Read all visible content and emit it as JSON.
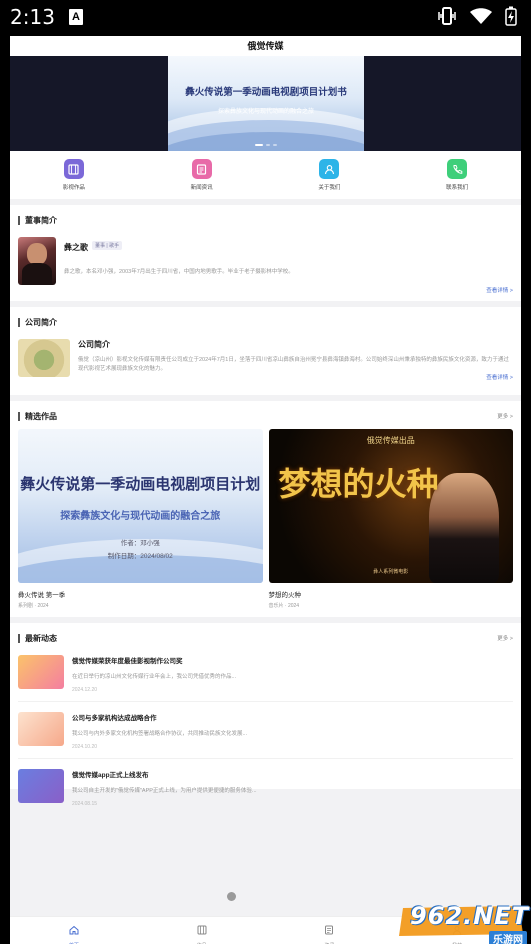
{
  "status_bar": {
    "time": "2:13",
    "notif_letter": "A"
  },
  "header": {
    "title": "俄觉传媒"
  },
  "banner": {
    "title": "彝火传说第一季动画电视剧项目计划书",
    "subtitle": "探索彝族文化与现代动画的融合之旅"
  },
  "quick_nav": [
    {
      "label": "影视作品",
      "icon": "film-icon",
      "color": "#7b68d8"
    },
    {
      "label": "新闻资讯",
      "icon": "news-icon",
      "color": "#e86aa8"
    },
    {
      "label": "关于我们",
      "icon": "user-icon",
      "color": "#2db4e8"
    },
    {
      "label": "联系我们",
      "icon": "phone-icon",
      "color": "#3ecf7a"
    }
  ],
  "chairman": {
    "section_title": "董事简介",
    "name": "彝之歌",
    "tag": "董事 | 歌手",
    "desc": "彝之歌，本名邓小强，2003年7月出生于四川省，中国内地男歌手。毕业于老子摄影林中学校。",
    "more": "查看详情 >"
  },
  "company": {
    "section_title": "公司简介",
    "name": "公司简介",
    "desc": "俄觉（凉山州）影视文化传媒有限责任公司成立于2024年7月1日，坐落于四川省凉山彝族自治州冕宁县彝海镇彝海村。公司始终深山州秉承独特的彝族民族文化资源，致力于通过现代影视艺术展现彝族文化的魅力。",
    "more": "查看详情 >"
  },
  "works": {
    "section_title": "精选作品",
    "more": "更多 >",
    "items": [
      {
        "name": "彝火传说 第一季",
        "meta": "系列剧 · 2024",
        "poster_title": "彝火传说第一季动画电视剧项目计划",
        "poster_sub": "探索彝族文化与现代动画的融合之旅",
        "poster_author": "作者：邓小强",
        "poster_date": "制作日期：2024/08/02"
      },
      {
        "name": "梦想的火种",
        "meta": "音乐片 · 2024",
        "poster_top": "俄觉传媒出品",
        "poster_big": "梦想的火种",
        "poster_bottom": "彝人系列微电影"
      }
    ]
  },
  "news": {
    "section_title": "最新动态",
    "more": "更多 >",
    "items": [
      {
        "title": "俄觉传媒荣获年度最佳影视制作公司奖",
        "desc": "在近日举行的凉山州文化传媒行业年会上，我公司凭借优秀的作品...",
        "date": "2024.12.20",
        "c1": "#fbc36a",
        "c2": "#f47ea0"
      },
      {
        "title": "公司与多家机构达成战略合作",
        "desc": "我公司与内外多家文化机构签署战略合作协议，共同推动民族文化发展...",
        "date": "2024.10.20",
        "c1": "#fcd9c0",
        "c2": "#f6a88a"
      },
      {
        "title": "俄觉传媒app正式上线发布",
        "desc": "我公司自主开发的\"俄觉传媒\"APP正式上线，为用户提供更便捷的服务体验...",
        "date": "2024.08.15",
        "c1": "#6a7ee0",
        "c2": "#8a5fc8"
      }
    ]
  },
  "tabbar": [
    {
      "label": "首页",
      "active": true
    },
    {
      "label": "作品",
      "active": false
    },
    {
      "label": "资讯",
      "active": false
    },
    {
      "label": "我的",
      "active": false
    }
  ],
  "watermark": {
    "text": "962.NET",
    "sub": "乐游网"
  }
}
